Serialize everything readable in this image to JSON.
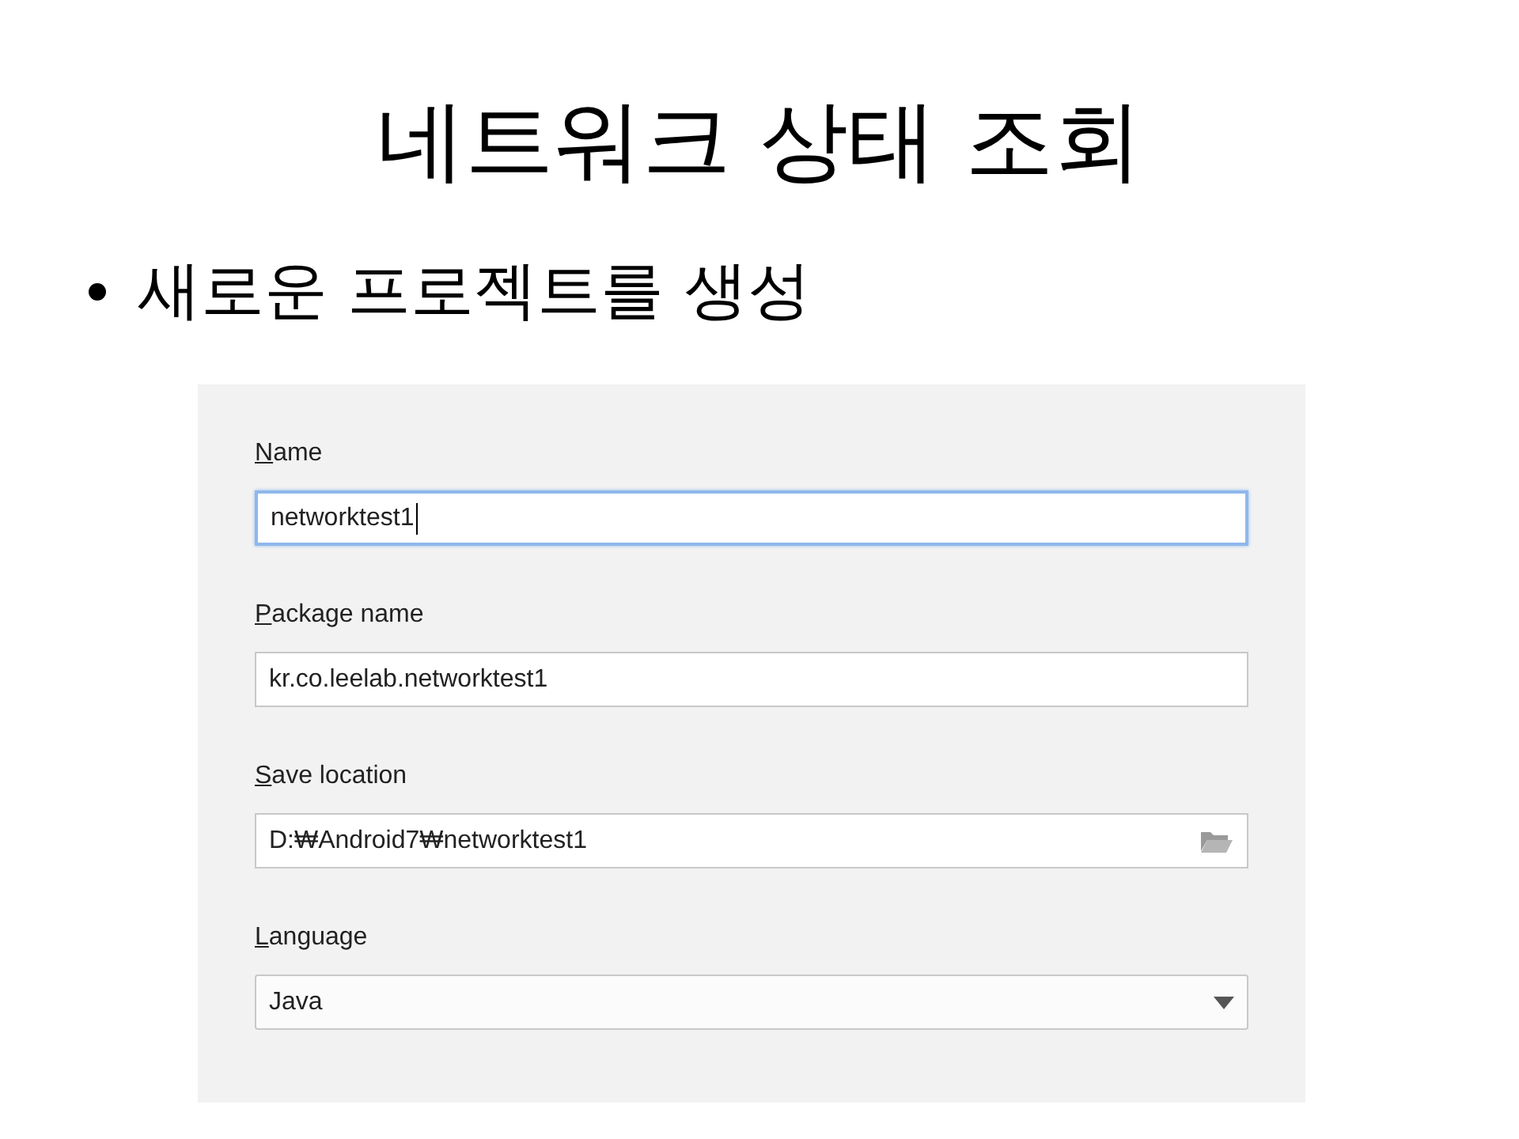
{
  "slide": {
    "title": "네트워크 상태 조회",
    "bullets": [
      "새로운 프로젝트를 생성"
    ]
  },
  "dialog": {
    "fields": [
      {
        "kind": "text",
        "label": "Name",
        "value": "networktest1",
        "focused": true,
        "mnemonic": true
      },
      {
        "kind": "text",
        "label": "Package name",
        "value": "kr.co.leelab.networktest1",
        "focused": false,
        "mnemonic": true
      },
      {
        "kind": "folder",
        "label": "Save location",
        "value": "D:₩Android7₩networktest1",
        "focused": false,
        "mnemonic": true
      },
      {
        "kind": "dropdown",
        "label": "Language",
        "value": "Java",
        "focused": false,
        "mnemonic": true
      }
    ]
  }
}
